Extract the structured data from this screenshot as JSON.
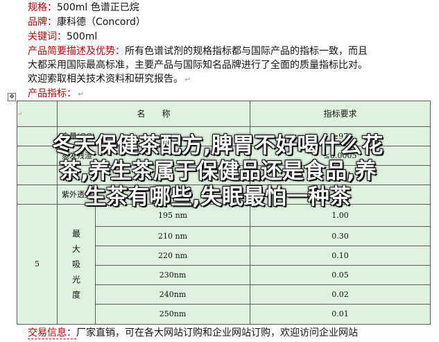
{
  "info": {
    "spec": {
      "label": "规格：",
      "value": "500ml 色谱正已烷"
    },
    "brand": {
      "label": "品牌：",
      "value": "康科德（Concord）"
    },
    "keyword": {
      "label": "关键词：",
      "value": "500ml"
    },
    "desc": {
      "label": "产品简要描述及优势：",
      "line1": "所有色谱试剂的规格指标都与国际产品的指标一致，而且",
      "line2": "大都采用国际最高标准，主要产品与国际知名品牌进行了全面的质量指标比对。",
      "line3": "欢迎索取相关技术资料和研究报告。"
    },
    "index_label": "产品指标："
  },
  "table": {
    "header": {
      "name": "名　　称",
      "req": "指标要求"
    },
    "rows": [
      {
        "no": "",
        "name": "含量(GC)",
        "req": "≥97"
      },
      {
        "no": "",
        "name": "蒸发残渣",
        "req": "≤0.0005"
      },
      {
        "no": "",
        "name": "水分",
        "req": "≤0.01"
      },
      {
        "no": "",
        "name": "紫外透光",
        "req": ""
      }
    ],
    "group": {
      "no": "5",
      "label": [
        "最",
        "大",
        "吸",
        "光",
        "度"
      ]
    },
    "absorbance": [
      {
        "wl": "195 nm",
        "val": "1.00"
      },
      {
        "wl": "210 nm",
        "val": "0.30"
      },
      {
        "wl": "220 nm",
        "val": "0.10"
      },
      {
        "wl": "230nm",
        "val": "0.05"
      },
      {
        "wl": "240nm",
        "val": "0.02"
      },
      {
        "wl": "250nm",
        "val": "0.01"
      }
    ]
  },
  "overlay": {
    "line1": "冬天保健茶配方,脾胃不好喝什么花",
    "line2": "茶,养生茶属于保健品还是食品,养",
    "line3": "生茶有哪些,失眠最怕一种茶"
  },
  "footer": {
    "label": "交易信息：",
    "value": "厂家直销，可在各大网站订购和企业网站订购，欢迎访问企业网站"
  },
  "colors": {
    "label": "#cc0000",
    "table_bg": "#dff2df",
    "overlay_text": "#ffffff"
  }
}
